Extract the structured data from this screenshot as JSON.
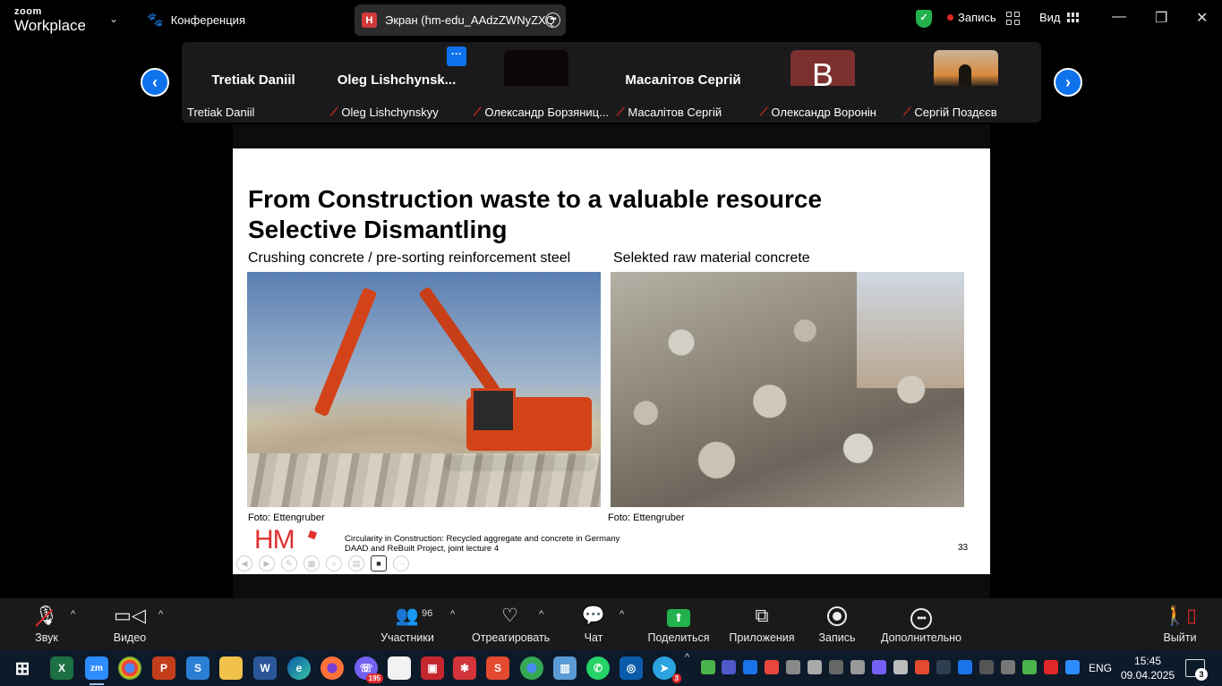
{
  "app": {
    "logo_top": "zoom",
    "logo_bottom": "Workplace",
    "meeting_label": "Конференция"
  },
  "share_pill": {
    "badge": "H",
    "title": "Экран (hm-edu_AAdzZWNyZXQ"
  },
  "header": {
    "recording_label": "Запись",
    "view_label": "Вид"
  },
  "participants": [
    {
      "big_name": "Tretiak Daniil",
      "caption": "Tretiak Daniil",
      "muted": false,
      "has_menu": false,
      "tile": "name"
    },
    {
      "big_name": "Oleg  Lishchynsk...",
      "caption": "Oleg Lishchynskyy",
      "muted": true,
      "has_menu": true,
      "tile": "name"
    },
    {
      "big_name": "",
      "caption": "Олександр Борзяниц...",
      "muted": true,
      "has_menu": true,
      "tile": "dark"
    },
    {
      "big_name": "Масалітов Сергій",
      "caption": "Масалітов Сергій",
      "muted": true,
      "has_menu": false,
      "tile": "name"
    },
    {
      "big_name": "B",
      "caption": "Олександр Воронін",
      "muted": true,
      "has_menu": false,
      "tile": "avatar"
    },
    {
      "big_name": "",
      "caption": "Сергій Поздєєв",
      "muted": true,
      "has_menu": false,
      "tile": "photo"
    }
  ],
  "slide": {
    "title_line1": "From Construction waste to a valuable resource",
    "title_line2": "Selective Dismantling",
    "caption_left": "Crushing concrete / pre-sorting reinforcement steel",
    "caption_right": "Selekted raw material concrete",
    "photo_credit_left": "Foto: Ettengruber",
    "photo_credit_right": "Foto: Ettengruber",
    "logo": "HM",
    "footer_line1": "Circularity in Construction: Recycled aggregate and concrete in Germany",
    "footer_line2": "DAAD and ReBuilt Project, joint lecture 4",
    "page_number": "33"
  },
  "toolbar": {
    "audio": "Звук",
    "video": "Видео",
    "participants": "Участники",
    "participants_count": "96",
    "react": "Отреагировать",
    "chat": "Чат",
    "share": "Поделиться",
    "apps": "Приложения",
    "record": "Запись",
    "more": "Дополнительно",
    "leave": "Выйти"
  },
  "taskbar": {
    "lang": "ENG",
    "time": "15:45",
    "date": "09.04.2025",
    "notifications": "3",
    "viber_badge": "195",
    "telegram_badge": "3",
    "colors": {
      "bg": "#0d1a2a",
      "accent": "#0e72ed",
      "green": "#22b14c",
      "red": "#e02828"
    }
  }
}
